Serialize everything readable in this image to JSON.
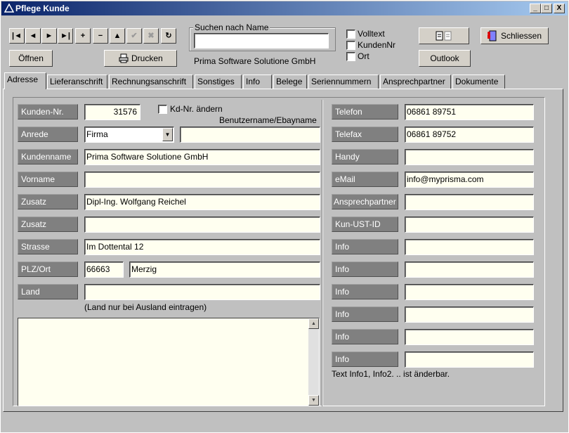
{
  "window": {
    "title": "Pflege Kunde"
  },
  "titlebar_buttons": {
    "minimize": "_",
    "maximize": "□",
    "close": "X"
  },
  "nav_buttons": [
    "|◄",
    "◄",
    "►",
    "►|",
    "+",
    "−",
    "▲",
    "✔",
    "✖",
    "↻"
  ],
  "toolbar": {
    "open_label": "Öffnen",
    "print_label": "Drucken",
    "search_label": "Suchen nach Name",
    "search_value": "",
    "company_display": "Prima Software Solutione GmbH",
    "volltext_label": "Volltext",
    "kundennr_label": "KundenNr",
    "ort_label": "Ort",
    "outlook_label": "Outlook",
    "close_label": "Schliessen"
  },
  "tabs": [
    "Adresse",
    "Lieferanschrift",
    "Rechnungsanschrift",
    "Sonstiges",
    "Info",
    "Belege",
    "Seriennummern",
    "Ansprechpartner",
    "Dokumente"
  ],
  "form": {
    "kunden_nr_label": "Kunden-Nr.",
    "kunden_nr_value": "31576",
    "kdnr_aendern_label": "Kd-Nr. ändern",
    "benutzername_label": "Benutzername/Ebayname",
    "benutzername_value": "",
    "anrede_label": "Anrede",
    "anrede_value": "Firma",
    "kundenname_label": "Kundenname",
    "kundenname_value": "Prima Software Solutione GmbH",
    "vorname_label": "Vorname",
    "vorname_value": "",
    "zusatz1_label": "Zusatz",
    "zusatz1_value": "Dipl-Ing. Wolfgang Reichel",
    "zusatz2_label": "Zusatz",
    "zusatz2_value": "",
    "strasse_label": "Strasse",
    "strasse_value": "Im Dottental 12",
    "plzort_label": "PLZ/Ort",
    "plz_value": "66663",
    "ort_value": "Merzig",
    "land_label": "Land",
    "land_value": "",
    "land_hint": "(Land nur bei Ausland eintragen)",
    "memo_value": ""
  },
  "contact": {
    "telefon_label": "Telefon",
    "telefon_value": "06861 89751",
    "telefax_label": "Telefax",
    "telefax_value": "06861 89752",
    "handy_label": "Handy",
    "handy_value": "",
    "email_label": "eMail",
    "email_value": "info@myprisma.com",
    "ansprechpartner_label": "Ansprechpartner",
    "ansprechpartner_value": "",
    "ustid_label": "Kun-UST-ID",
    "ustid_value": "",
    "info_labels": [
      "Info",
      "Info",
      "Info",
      "Info",
      "Info",
      "Info"
    ],
    "info_values": [
      "",
      "",
      "",
      "",
      "",
      ""
    ],
    "info_hint": "Text Info1, Info2. .. ist änderbar."
  },
  "colors": {
    "title_start": "#0a246a",
    "title_end": "#a6caf0",
    "field_bg": "#fffff0",
    "label_bg": "#808080"
  }
}
